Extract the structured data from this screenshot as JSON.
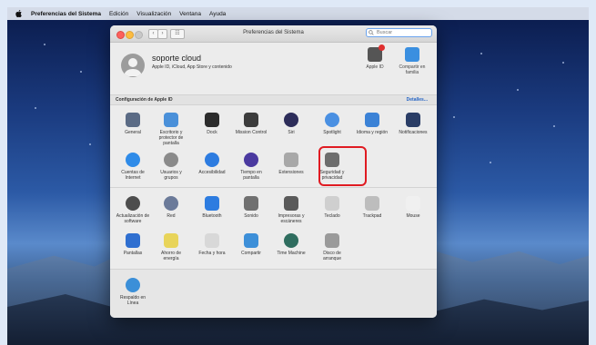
{
  "menubar": {
    "app_name": "Preferencias del Sistema",
    "items": [
      "Edición",
      "Visualización",
      "Ventana",
      "Ayuda"
    ]
  },
  "window": {
    "title": "Preferencias del Sistema",
    "back_glyph": "‹",
    "forward_glyph": "›",
    "grid_glyph": "☷",
    "search_placeholder": "Buscar"
  },
  "account": {
    "name": "soporte cloud",
    "subtitle": "Apple ID, iCloud, App Store y contenido",
    "apple_id_label": "Apple ID",
    "family_label": "Compartir en familia"
  },
  "apple_band": {
    "label": "Configuración de Apple ID",
    "details": "Detalles..."
  },
  "section1": [
    {
      "label": "General",
      "icon": "general-icon",
      "color": "#5b6b85"
    },
    {
      "label": "Escritorio y protector de pantalla",
      "icon": "desktop-icon",
      "color": "#4a90d9"
    },
    {
      "label": "Dock",
      "icon": "dock-icon",
      "color": "#2c2c2c"
    },
    {
      "label": "Mission Control",
      "icon": "mission-control-icon",
      "color": "#3c3c3c"
    },
    {
      "label": "Siri",
      "icon": "siri-icon",
      "color": "#2d2d5a"
    },
    {
      "label": "Spotlight",
      "icon": "spotlight-icon",
      "color": "#4a90e2"
    },
    {
      "label": "Idioma y región",
      "icon": "language-icon",
      "color": "#3b82d6"
    },
    {
      "label": "Notificaciones",
      "icon": "notifications-icon",
      "color": "#2a3d66"
    },
    {
      "label": "Cuentas de Internet",
      "icon": "internet-accounts-icon",
      "color": "#2f8be8"
    },
    {
      "label": "Usuarios y grupos",
      "icon": "users-groups-icon",
      "color": "#8a8a8a"
    },
    {
      "label": "Accesibilidad",
      "icon": "accessibility-icon",
      "color": "#2d7ce0"
    },
    {
      "label": "Tiempo en pantalla",
      "icon": "screen-time-icon",
      "color": "#4b3aa0"
    },
    {
      "label": "Extensiones",
      "icon": "extensions-icon",
      "color": "#a8a8a8"
    },
    {
      "label": "Seguridad y privacidad",
      "icon": "security-privacy-icon",
      "color": "#6d6d6d"
    }
  ],
  "section2": [
    {
      "label": "Actualización de software",
      "icon": "software-update-icon",
      "color": "#4d4d4d"
    },
    {
      "label": "Red",
      "icon": "network-icon",
      "color": "#6b7a99"
    },
    {
      "label": "Bluetooth",
      "icon": "bluetooth-icon",
      "color": "#2d7ce0"
    },
    {
      "label": "Sonido",
      "icon": "sound-icon",
      "color": "#707070"
    },
    {
      "label": "Impresoras y escáneres",
      "icon": "printers-icon",
      "color": "#5a5a5a"
    },
    {
      "label": "Teclado",
      "icon": "keyboard-icon",
      "color": "#cfcfcf"
    },
    {
      "label": "Trackpad",
      "icon": "trackpad-icon",
      "color": "#bdbdbd"
    },
    {
      "label": "Mouse",
      "icon": "mouse-icon",
      "color": "#f0f0f0"
    },
    {
      "label": "Pantallas",
      "icon": "displays-icon",
      "color": "#2f6fd0"
    },
    {
      "label": "Ahorro de energía",
      "icon": "energy-saver-icon",
      "color": "#e8d45a"
    },
    {
      "label": "Fecha y hora",
      "icon": "date-time-icon",
      "color": "#d8d8d8"
    },
    {
      "label": "Compartir",
      "icon": "sharing-icon",
      "color": "#3d8fd8"
    },
    {
      "label": "Time Machine",
      "icon": "time-machine-icon",
      "color": "#2f6d5f"
    },
    {
      "label": "Disco de arranque",
      "icon": "startup-disk-icon",
      "color": "#9a9a9a"
    }
  ],
  "section3": [
    {
      "label": "Respaldo en Línea",
      "icon": "online-backup-icon",
      "color": "#3b8fd8"
    }
  ],
  "highlight_color": "#e01b22"
}
